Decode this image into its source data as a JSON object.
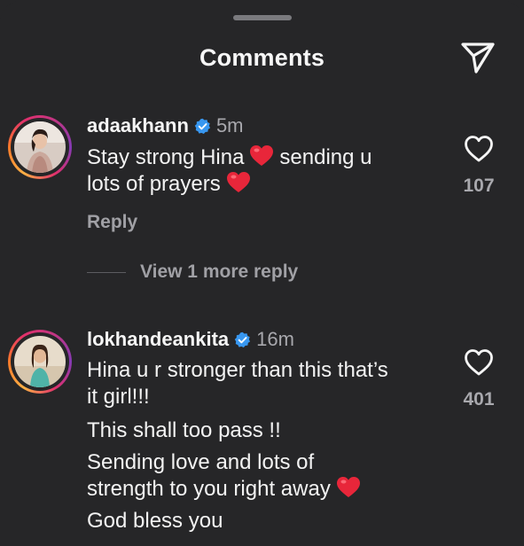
{
  "header": {
    "title": "Comments",
    "share_icon": "paper-plane-icon"
  },
  "comments": [
    {
      "username": "adaakhann",
      "verified": true,
      "time": "5m",
      "text_parts": [
        "Stay strong Hina",
        "sending u",
        "lots of prayers"
      ],
      "emoji": "red-heart",
      "likes": "107",
      "reply_label": "Reply",
      "view_replies_label": "View 1 more reply"
    },
    {
      "username": "lokhandeankita",
      "verified": true,
      "time": "16m",
      "lines": [
        "Hina u r stronger than this that’s",
        "it girl!!!",
        "This shall too pass !!",
        "Sending love and lots of",
        "strength to you right away",
        "God bless you"
      ],
      "emoji": "red-heart",
      "likes": "401"
    }
  ],
  "colors": {
    "background": "#262628",
    "text": "#f5f5f5",
    "muted": "#a8a8ad",
    "verified_badge": "#3897f0",
    "heart_emoji": "#e8263a"
  }
}
